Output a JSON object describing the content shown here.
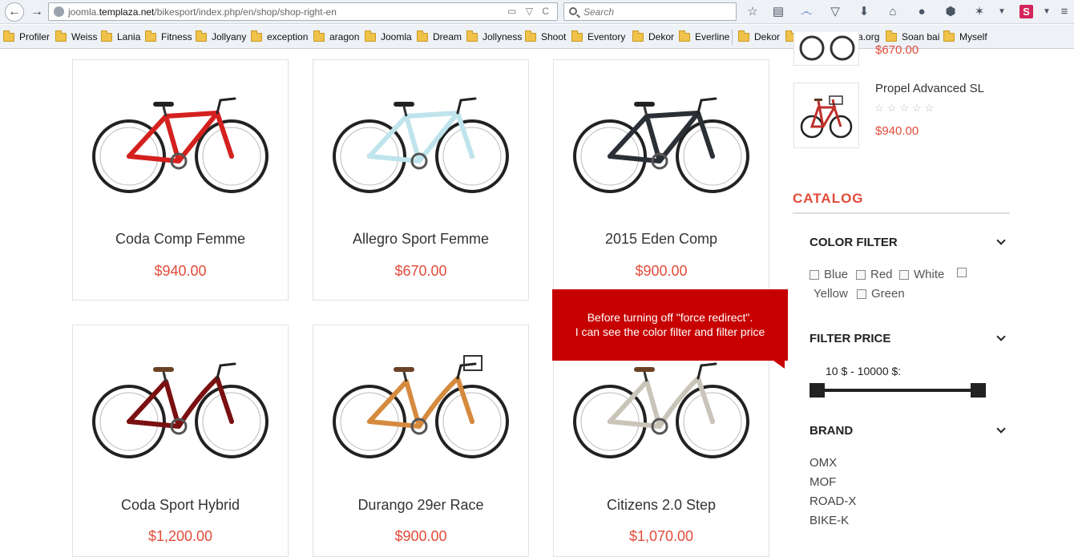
{
  "browser": {
    "url_prefix": "joomla.",
    "url_domain": "templaza.net",
    "url_path": "/bikesport/index.php/en/shop/shop-right-en",
    "url_tools": "▭ ▽ C",
    "search_placeholder": "Search"
  },
  "bookmarks": [
    "Profiler",
    "Weiss",
    "Lania",
    "Fitness",
    "Jollyany",
    "exception",
    "aragon",
    "Joomla",
    "Dream",
    "Jollyness",
    "Shoot",
    "Eventory",
    "Dekor",
    "Everline",
    "Dekor",
    "My site joomla.org",
    "Soan bai",
    "Myself"
  ],
  "products": [
    {
      "name": "Coda Comp Femme",
      "price": "$940.00",
      "frame_color": "#d4201e"
    },
    {
      "name": "Allegro Sport Femme",
      "price": "$670.00",
      "frame_color": "#bfe4ec"
    },
    {
      "name": "2015 Eden Comp",
      "price": "$900.00",
      "frame_color": "#2b2f36"
    },
    {
      "name": "Coda Sport Hybrid",
      "price": "$1,200.00",
      "frame_color": "#7a1010"
    },
    {
      "name": "Durango 29er Race",
      "price": "$900.00",
      "frame_color": "#d58a3e"
    },
    {
      "name": "Citizens 2.0 Step",
      "price": "$1,070.00",
      "frame_color": "#c9c4b8"
    }
  ],
  "tooltip": {
    "line1": "Before turning off \"force redirect\".",
    "line2": "I can see the color filter and filter price"
  },
  "sidebar": {
    "top_price": "$670.00",
    "mini_product": {
      "name": "Propel Advanced SL",
      "price": "$940.00",
      "stars": "☆☆☆☆☆"
    },
    "catalog_title": "CATALOG",
    "color_filter": {
      "title": "COLOR FILTER",
      "options": [
        "Blue",
        "Red",
        "White",
        "Yellow",
        "Green"
      ]
    },
    "filter_price": {
      "title": "FILTER PRICE",
      "range": "10 $ - 10000 $:",
      "min_fraction": 0,
      "max_fraction": 1
    },
    "brand": {
      "title": "BRAND",
      "items": [
        "OMX",
        "MOF",
        "ROAD-X",
        "BIKE-K"
      ]
    }
  }
}
